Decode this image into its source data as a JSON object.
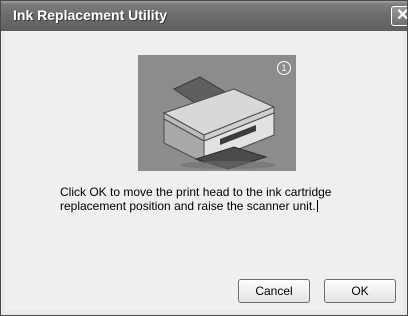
{
  "window": {
    "title": "Ink Replacement Utility"
  },
  "illustration": {
    "step_badge": "1"
  },
  "message": "Click OK to move the print head to the ink cartridge replacement position and raise the scanner unit.",
  "buttons": {
    "cancel_label": "Cancel",
    "ok_label": "OK"
  },
  "colors": {
    "titlebar": "#6c6c6c",
    "client": "#efefef",
    "illustration_bg": "#8c8c8c"
  }
}
